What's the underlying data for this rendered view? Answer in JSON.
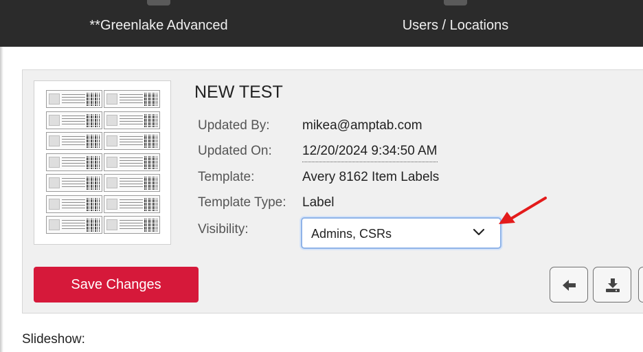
{
  "nav": {
    "items": [
      {
        "label": "**Greenlake Advanced"
      },
      {
        "label": "Users / Locations"
      }
    ]
  },
  "template": {
    "title": "NEW TEST",
    "fields": {
      "updated_by_label": "Updated By:",
      "updated_by_value": "mikea@amptab.com",
      "updated_on_label": "Updated On:",
      "updated_on_value": "12/20/2024 9:34:50 AM",
      "template_label": "Template:",
      "template_value": "Avery 8162 Item Labels",
      "template_type_label": "Template Type:",
      "template_type_value": "Label",
      "visibility_label": "Visibility:",
      "visibility_value": "Admins, CSRs"
    }
  },
  "actions": {
    "save_label": "Save Changes"
  },
  "sections": {
    "slideshow_label": "Slideshow:"
  },
  "colors": {
    "topbar": "#2b2b2b",
    "save_button": "#d6193a",
    "focus_border": "#8fb3e8",
    "annotation_arrow": "#e31b1b"
  },
  "icons": {
    "back": "arrow-left-icon",
    "download": "download-icon",
    "dropdown": "chevron-down-icon"
  }
}
